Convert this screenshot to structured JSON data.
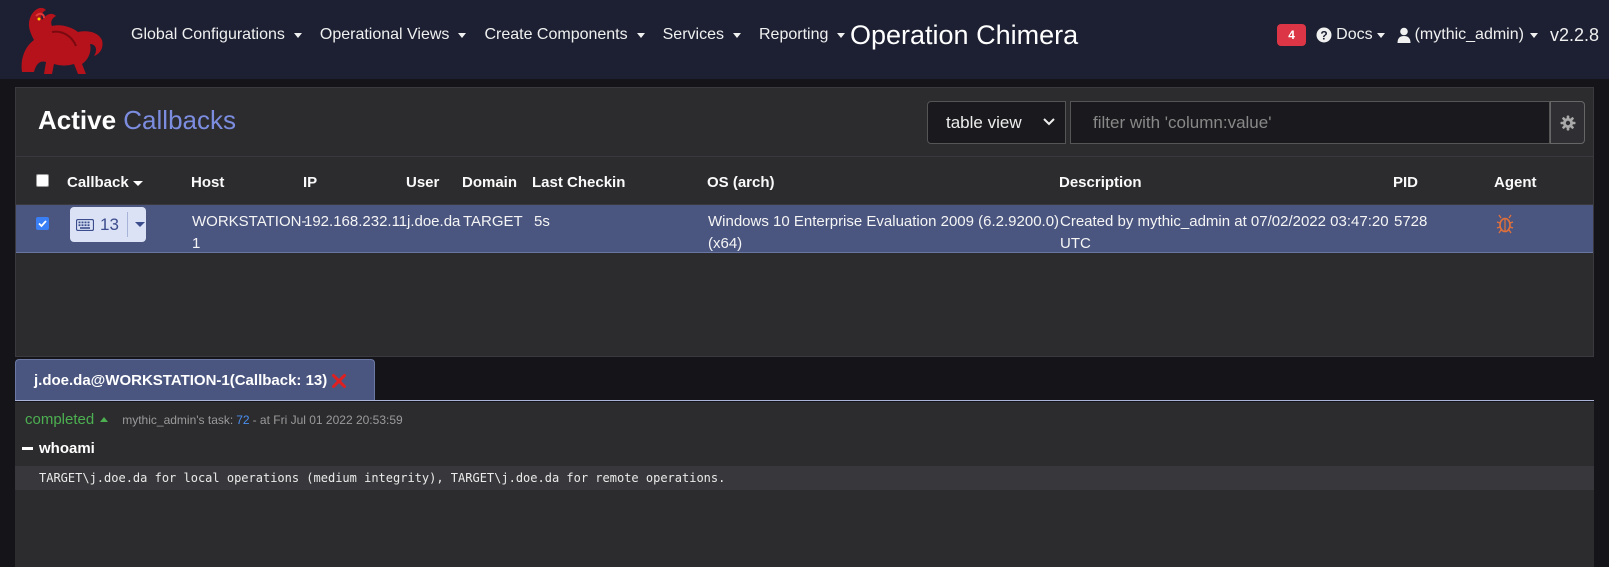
{
  "nav": {
    "menus": [
      {
        "label": "Global Configurations"
      },
      {
        "label": "Operational Views"
      },
      {
        "label": "Create Components"
      },
      {
        "label": "Services"
      },
      {
        "label": "Reporting"
      }
    ],
    "operation_title": "Operation Chimera",
    "alert_count": "4",
    "docs_label": "Docs",
    "user_label": "(mythic_admin)",
    "version": "v2.2.8"
  },
  "callbacks": {
    "title_main": "Active",
    "title_accent": "Callbacks",
    "view_select": "table view",
    "filter_placeholder": "filter with 'column:value'",
    "columns": {
      "callback": "Callback",
      "host": "Host",
      "ip": "IP",
      "user": "User",
      "domain": "Domain",
      "last_checkin": "Last Checkin",
      "os": "OS (arch)",
      "description": "Description",
      "pid": "PID",
      "agent": "Agent"
    },
    "row": {
      "callback_id": "13",
      "host_line1": "WORKSTATION-",
      "host_line2": "1",
      "ip": "192.168.232.11",
      "user": "j.doe.da",
      "domain": "TARGET",
      "last_checkin": "5s",
      "os_line1": "Windows 10 Enterprise Evaluation 2009 (6.2.9200.0)",
      "os_line2": "(x64)",
      "desc_line1": "Created by mythic_admin at 07/02/2022 03:47:20",
      "desc_line2": "UTC",
      "pid": "5728",
      "agent_icon": "bug-icon",
      "selected": true
    }
  },
  "task_tab": {
    "label": "j.doe.da@WORKSTATION-1(Callback: 13)"
  },
  "task": {
    "status": "completed",
    "owner_text": "mythic_admin's task:",
    "task_id": "72",
    "time_text": "- at Fri Jul 01 2022 20:53:59",
    "command": "whoami",
    "output": "TARGET\\j.doe.da for local operations (medium integrity), TARGET\\j.doe.da for remote operations."
  },
  "colors": {
    "navbar": "#1c2032",
    "accent": "#7c8de0",
    "selected_row": "#4b5680",
    "status_green": "#4caf50",
    "alert_red": "#dc3545"
  }
}
